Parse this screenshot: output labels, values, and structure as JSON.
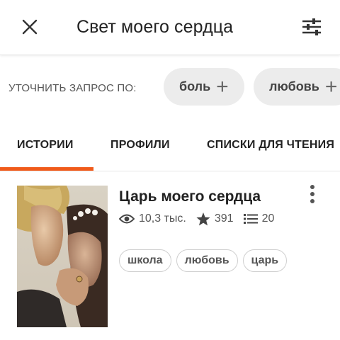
{
  "header": {
    "title": "Свет моего сердца",
    "close_icon": "close-icon",
    "filter_icon": "filter-sliders-icon"
  },
  "refine": {
    "label": "УТОЧНИТЬ ЗАПРОС ПО:",
    "chips": [
      {
        "label": "боль",
        "icon": "plus-icon"
      },
      {
        "label": "любовь",
        "icon": "plus-icon"
      }
    ]
  },
  "tabs": [
    {
      "label": "ИСТОРИИ",
      "active": true
    },
    {
      "label": "ПРОФИЛИ",
      "active": false
    },
    {
      "label": "СПИСКИ ДЛЯ ЧТЕНИЯ",
      "active": false
    }
  ],
  "accent_color": "#f05a1a",
  "story": {
    "title": "Царь моего сердца",
    "reads": "10,3 тыс.",
    "votes": "391",
    "parts": "20",
    "tags": [
      "школа",
      "любовь",
      "царь"
    ],
    "cover_image": "cover-photo-couple"
  }
}
